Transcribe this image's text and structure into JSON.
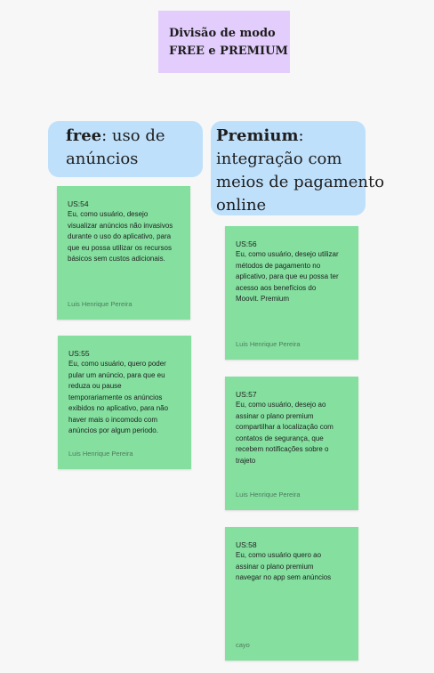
{
  "title": {
    "line1": "Divisão de modo",
    "line2": "FREE e PREMIUM"
  },
  "columns": {
    "free": {
      "bold": "free",
      "rest": ": uso de",
      "line2": "anúncios"
    },
    "premium": {
      "bold": "Premium",
      "rest": ":",
      "line2": "integração com",
      "line3": "meios de pagamento",
      "line4": "online"
    }
  },
  "stories": {
    "us54": {
      "id": "US:54",
      "lines": [
        "Eu, como usuário, desejo",
        "visualizar anúncios não invasivos",
        "durante o uso do aplicativo, para",
        "que eu possa utilizar os recursos",
        "básicos sem custos adicionais."
      ],
      "author": "Luis Henrique Pereira"
    },
    "us55": {
      "id": "US:55",
      "lines": [
        "Eu, como usuário, quero poder",
        "pular  um anúncio, para que eu",
        "reduza ou pause",
        "temporariamente os anúncios",
        "exibidos no aplicativo, para não",
        "haver mais o incomodo com",
        "anúncios por algum periodo."
      ],
      "author": "Luis Henrique Pereira"
    },
    "us56": {
      "id": "US:56",
      "lines": [
        "Eu, como usuário, desejo utilizar",
        "métodos de pagamento no",
        "aplicativo, para que eu possa ter",
        "acesso aos benefícios do",
        "Moovit. Premium"
      ],
      "author": "Luis Henrique Pereira"
    },
    "us57": {
      "id": "US:57",
      "lines": [
        "Eu, como usuário, desejo ao",
        "assinar o plano premium",
        "compartilhar a localização com",
        "contatos de segurança, que",
        "recebem notificações sobre o",
        "trajeto"
      ],
      "author": "Luis Henrique Pereira"
    },
    "us58": {
      "id": "US:58",
      "lines": [
        "Eu, como usuário quero ao",
        "assinar o plano premium",
        "navegar no app sem anúncios"
      ],
      "author": "cayo"
    }
  },
  "colors": {
    "background": "#f7f7f7",
    "title_note": "#e3cdfc",
    "column_header": "#bfe0fb",
    "sticky_note": "#85e0a0"
  }
}
